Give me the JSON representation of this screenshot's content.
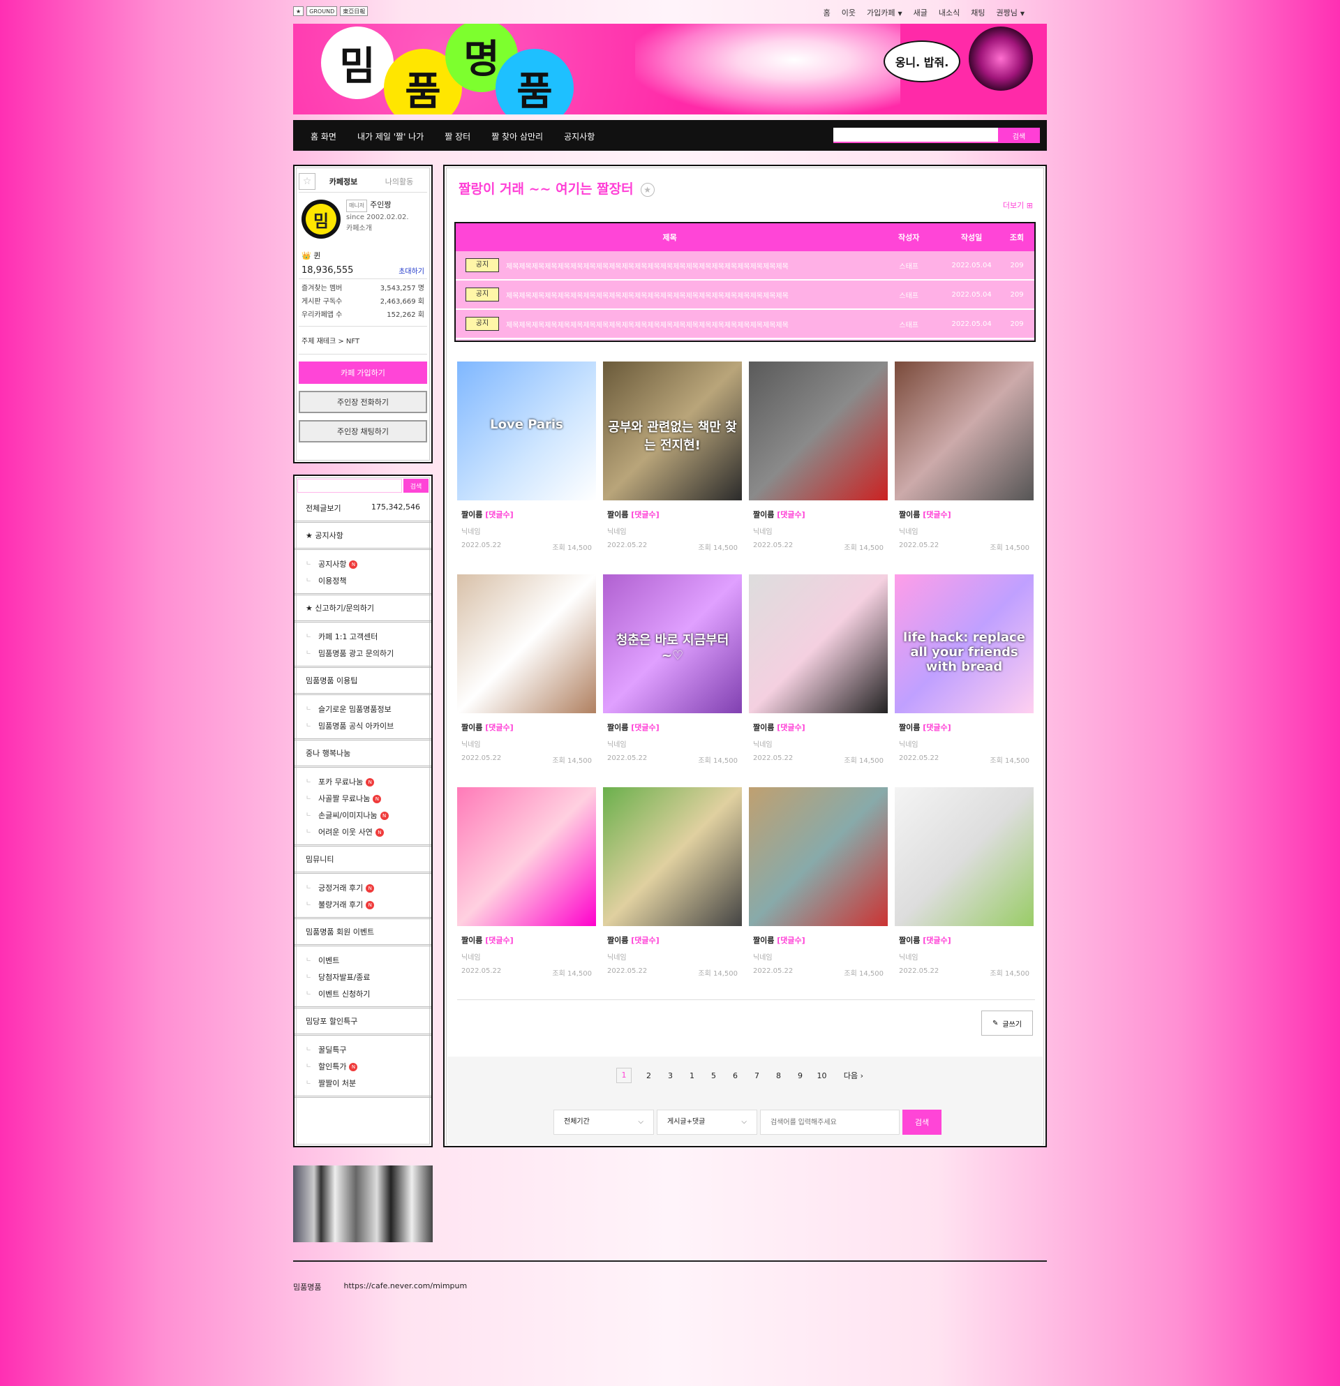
{
  "util": {
    "logos": [
      "GROUND",
      "東亞日報"
    ],
    "nav": [
      "홈",
      "이웃",
      "가입카페",
      "새글",
      "내소식",
      "채팅",
      "권짱님"
    ]
  },
  "banner": {
    "chars": [
      "밈",
      "품",
      "명",
      "품"
    ],
    "bubble": "옹니. 밥줘."
  },
  "gnb": {
    "items": [
      "홈 화면",
      "내가 제일 '짤' 나가",
      "짤 장터",
      "짤 찾아 삼만리",
      "공지사항"
    ],
    "search_btn": "검색"
  },
  "cafe": {
    "tab1": "카페정보",
    "tab2": "나의활동",
    "badge": "매니저",
    "manager": "주인짱",
    "since": "since 2002.02.02.",
    "intro": "카페소개",
    "rank": "퀸",
    "members": "18,936,555",
    "invite": "초대하기",
    "stats": [
      {
        "k": "즐겨찾는 멤버",
        "v": "3,543,257 명"
      },
      {
        "k": "게시판 구독수",
        "v": "2,463,669 회"
      },
      {
        "k": "우리카페앱 수",
        "v": "152,262 회"
      }
    ],
    "topic": "주제    재테크 > NFT",
    "join": "카페 가입하기",
    "call": "주인장 전화하기",
    "chat": "주인장 채팅하기",
    "avatar": "밈"
  },
  "menu": {
    "search_btn": "검색",
    "all": "전체글보기",
    "all_count": "175,342,546",
    "sections": [
      {
        "head": "★ 공지사항",
        "items": [
          {
            "l": "공지사항",
            "n": true
          },
          {
            "l": "이용정책",
            "n": false
          }
        ]
      },
      {
        "head": "★ 신고하기/문의하기",
        "items": [
          {
            "l": "카페 1:1 고객센터",
            "n": false
          },
          {
            "l": "밈품명품 광고 문의하기",
            "n": false
          }
        ]
      },
      {
        "head": "밈품명품 이용팁",
        "items": [
          {
            "l": "슬기로운 밈품명품정보",
            "n": false
          },
          {
            "l": "밈품명품 공식 아카이브",
            "n": false
          }
        ]
      },
      {
        "head": "중나 행복나눔",
        "items": [
          {
            "l": "포카 무료나눔",
            "n": true
          },
          {
            "l": "사골짤 무료나눔",
            "n": true
          },
          {
            "l": "손글씨/이미지나눔",
            "n": true
          },
          {
            "l": "어려운 이웃 사연",
            "n": true
          }
        ]
      },
      {
        "head": "밈뮤니티",
        "items": [
          {
            "l": "긍정거래 후기",
            "n": true
          },
          {
            "l": "불량거래 후기",
            "n": true
          }
        ]
      },
      {
        "head": "밈품명품 회원 이벤트",
        "items": [
          {
            "l": "이벤트",
            "n": false
          },
          {
            "l": "당첨자발표/종료",
            "n": false
          },
          {
            "l": "이벤트 신청하기",
            "n": false
          }
        ]
      },
      {
        "head": "밈당포 할인특구",
        "items": [
          {
            "l": "꿀딜특구",
            "n": false
          },
          {
            "l": "할인특가",
            "n": true
          },
          {
            "l": "짤짤이 처분",
            "n": false
          }
        ]
      }
    ]
  },
  "board": {
    "title": "짤랑이 거래 ~~ 여기는 짤장터",
    "more": "더보기",
    "cols": [
      "제목",
      "작성자",
      "작성일",
      "조회"
    ],
    "notices": [
      {
        "tag": "공지",
        "title": "제목제목제목제목제목제목제목제목제목제목제목제목제목제목제목제목제목제목제목제목제목제목",
        "author": "스태프",
        "date": "2022.05.04",
        "views": "209"
      },
      {
        "tag": "공지",
        "title": "제목제목제목제목제목제목제목제목제목제목제목제목제목제목제목제목제목제목제목제목제목제목",
        "author": "스태프",
        "date": "2022.05.04",
        "views": "209"
      },
      {
        "tag": "공지",
        "title": "제목제목제목제목제목제목제목제목제목제목제목제목제목제목제목제목제목제목제목제목제목제목",
        "author": "스태프",
        "date": "2022.05.04",
        "views": "209"
      }
    ],
    "post": {
      "title": "짤이름",
      "comments": "[댓글수]",
      "nick": "닉네임",
      "date": "2022.05.22",
      "views": "조회 14,500"
    },
    "thumb_overlays": [
      "Love Paris",
      "공부와 관련없는 책만 찾는 전지현!",
      "",
      "",
      "",
      "청춘은 바로 지금부터~♡",
      "",
      "life hack: replace all your friends with bread",
      "",
      "",
      "",
      ""
    ],
    "write": "글쓰기",
    "pages": [
      "1",
      "2",
      "3",
      "1",
      "5",
      "6",
      "7",
      "8",
      "9",
      "10"
    ],
    "next": "다음 ›",
    "period": "전체기간",
    "scope": "게시글+댓글",
    "search_placeholder": "검색어를 입력해주세요",
    "search_btn": "검색"
  },
  "footer": {
    "name": "밈품명품",
    "url": "https://cafe.never.com/mimpum"
  },
  "colors": {
    "accent": "#ff45d7",
    "title": "#ff3fd6"
  }
}
